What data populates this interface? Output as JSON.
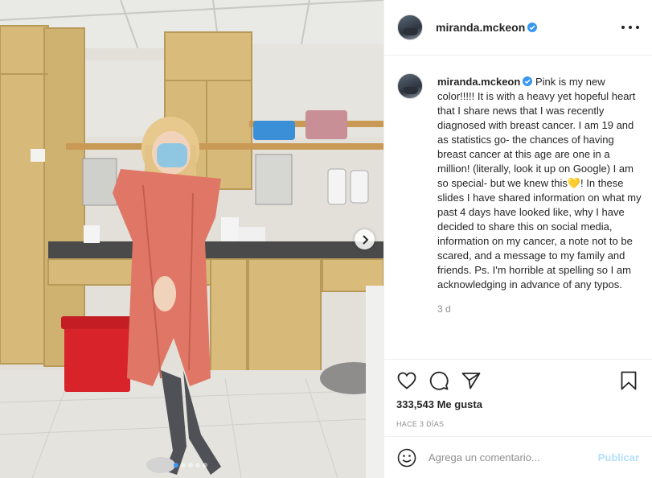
{
  "post": {
    "username": "miranda.mckeon",
    "verified": true,
    "caption": "Pink is my new color!!!!! It is with a heavy yet hopeful heart that I share news that I was recently diagnosed with breast cancer. I am 19 and as statistics go- the chances of having breast cancer at this age are one in a million! (literally, look it up on Google) I am so special- but we knew this💛! In these slides I have shared information on what my past 4 days have looked like, why I have decided to share this on social media, information on my cancer, a note not to be scared, and a message to my family and friends. Ps. I'm horrible at spelling so I am acknowledging in advance of any typos.",
    "time_ago": "3 d",
    "likes": "333,543 Me gusta",
    "date": "HACE 3 DÍAS"
  },
  "carousel": {
    "slide_count": 5,
    "active_index": 0
  },
  "comment": {
    "placeholder": "Agrega un comentario...",
    "post_label": "Publicar"
  },
  "icons": {
    "verified": "verified-badge-icon",
    "more": "more-options-icon",
    "like": "heart-icon",
    "comment": "comment-icon",
    "share": "paper-plane-icon",
    "save": "bookmark-icon",
    "emoji": "smiley-icon",
    "next": "chevron-right-icon"
  },
  "colors": {
    "accent": "#3897f0",
    "verified": "#3897f0",
    "post_disabled": "#b2dffc",
    "text": "#262626",
    "muted": "#8e8e8e"
  }
}
